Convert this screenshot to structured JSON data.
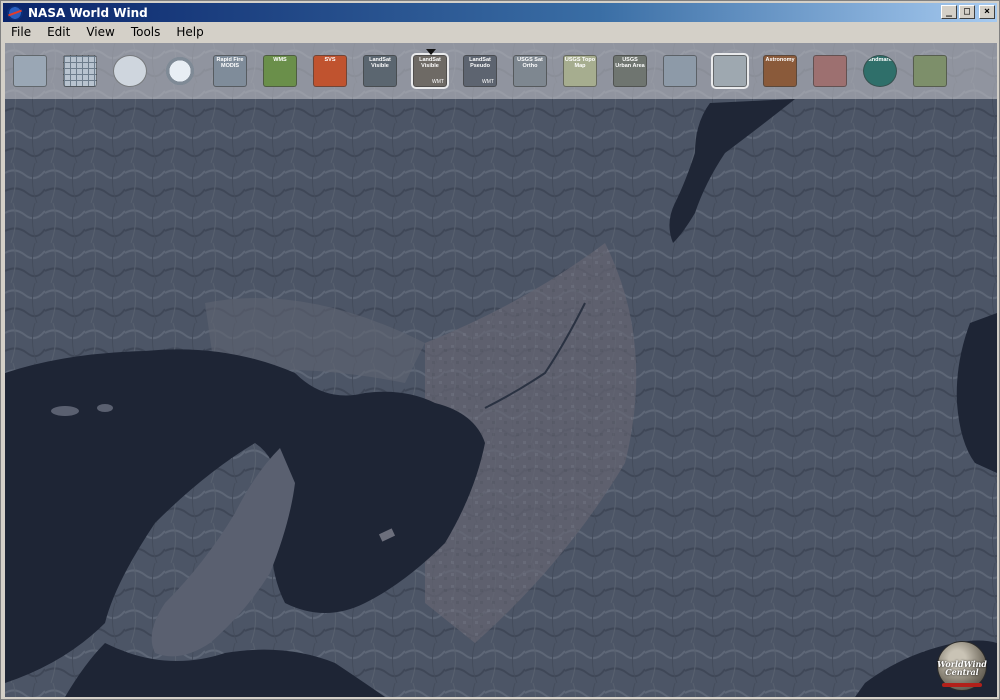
{
  "window": {
    "title": "NASA World Wind"
  },
  "titlebar_buttons": {
    "minimize": "_",
    "maximize": "□",
    "close": "×"
  },
  "menu": [
    {
      "label": "File"
    },
    {
      "label": "Edit"
    },
    {
      "label": "View"
    },
    {
      "label": "Tools"
    },
    {
      "label": "Help"
    }
  ],
  "toolbar": [
    {
      "name": "layer-manager-icon",
      "label": "",
      "sub": "",
      "bg": "#9aa7b5",
      "icon": "layers"
    },
    {
      "name": "lat-lon-grid-icon",
      "label": "",
      "sub": "",
      "bg": "#b8c3cf",
      "icon": "grid"
    },
    {
      "name": "globe-icon",
      "label": "",
      "sub": "",
      "bg": "#cfd6de",
      "icon": "globe"
    },
    {
      "name": "search-icon",
      "label": "",
      "sub": "",
      "bg": "#c9ccd0",
      "icon": "search"
    },
    {
      "name": "rapid-fire-modis-icon",
      "label": "Rapid Fire MODIS",
      "sub": "",
      "bg": "#7f8c9a",
      "icon": "chip"
    },
    {
      "name": "wms-icon",
      "label": "WMS",
      "sub": "",
      "bg": "#6a8f4a",
      "icon": "chip"
    },
    {
      "name": "svs-icon",
      "label": "SVS",
      "sub": "",
      "bg": "#c0532f",
      "icon": "chip"
    },
    {
      "name": "landsat-visible-icon",
      "label": "LandSat Visible",
      "sub": "",
      "bg": "#5b6670",
      "icon": "chip"
    },
    {
      "name": "landsat-visible-wmt-icon",
      "label": "LandSat Visible",
      "sub": "WMT",
      "bg": "#6e6a65",
      "icon": "chip",
      "selected": true
    },
    {
      "name": "landsat-pseudo-icon",
      "label": "LandSat Pseudo",
      "sub": "WMT",
      "bg": "#5d6470",
      "icon": "chip"
    },
    {
      "name": "usgs-sat-ortho-icon",
      "label": "USGS Sat Ortho",
      "sub": "",
      "bg": "#7e8790",
      "icon": "chip"
    },
    {
      "name": "usgs-topo-map-icon",
      "label": "USGS Topo Map",
      "sub": "",
      "bg": "#a6ad8f",
      "icon": "chip"
    },
    {
      "name": "usgs-urban-area-icon",
      "label": "USGS Urban Area",
      "sub": "",
      "bg": "#6f7570",
      "icon": "chip"
    },
    {
      "name": "world-map-icon",
      "label": "",
      "sub": "",
      "bg": "#8d9aa8",
      "icon": "chip"
    },
    {
      "name": "place-names-icon",
      "label": "",
      "sub": "",
      "bg": "#9ea8b0",
      "icon": "chip",
      "selected": true
    },
    {
      "name": "astronomy-icon",
      "label": "Astronomy",
      "sub": "",
      "bg": "#8a5a3a",
      "icon": "chip"
    },
    {
      "name": "flags-icon",
      "label": "",
      "sub": "",
      "bg": "#9d7070",
      "icon": "chip"
    },
    {
      "name": "landmarks-icon",
      "label": "Landmarks",
      "sub": "",
      "bg": "#2f6f6a",
      "icon": "round"
    },
    {
      "name": "us-states-icon",
      "label": "",
      "sub": "",
      "bg": "#7d8f6a",
      "icon": "chip"
    }
  ],
  "logo": {
    "text": "WorldWind Central"
  }
}
